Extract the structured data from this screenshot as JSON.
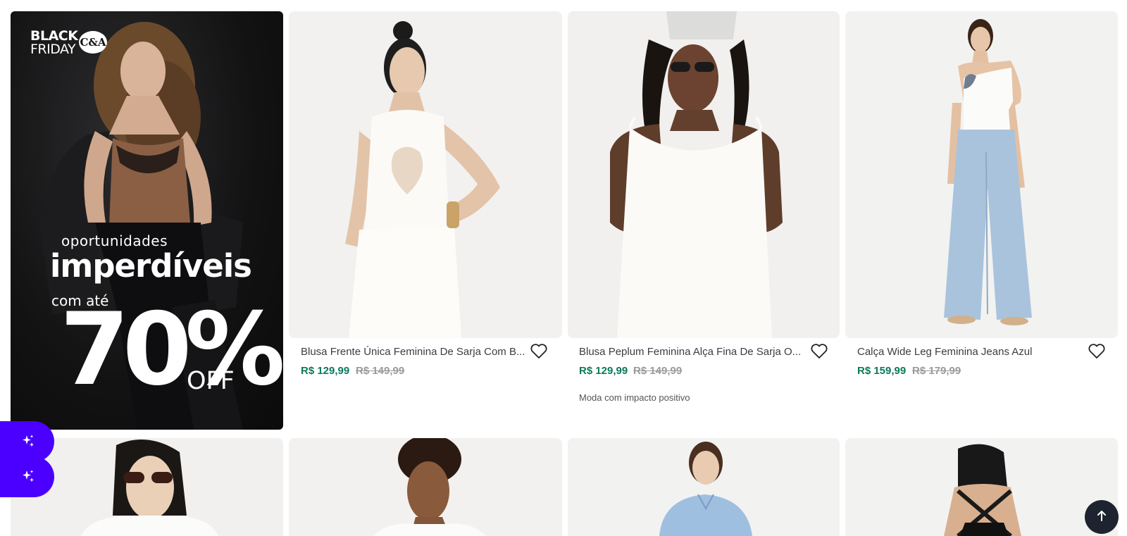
{
  "banner": {
    "logo_black": "BLACK",
    "logo_friday": "FRIDAY",
    "logo_brand": "C&A",
    "line1": "oportunidades",
    "line2": "imperdíveis",
    "line3": "com até",
    "big": "70%",
    "off": "OFF"
  },
  "products": [
    {
      "name": "Blusa Frente Única Feminina De Sarja Com Bordado Off White",
      "display_name": "Blusa Frente Única Feminina De Sarja Com B...",
      "price": "R$ 129,99",
      "old_price": "R$ 149,99",
      "tag": ""
    },
    {
      "name": "Blusa Peplum Feminina Alça Fina De Sarja Off White",
      "display_name": "Blusa Peplum Feminina Alça Fina De Sarja O...",
      "price": "R$ 129,99",
      "old_price": "R$ 149,99",
      "tag": "Moda com impacto positivo"
    },
    {
      "name": "Calça Wide Leg Feminina Jeans Azul",
      "display_name": "Calça Wide Leg Feminina Jeans Azul",
      "price": "R$ 159,99",
      "old_price": "R$ 179,99",
      "tag": ""
    }
  ],
  "colors": {
    "price": "#0b7a5a",
    "old_price": "#9a9a9a",
    "assistant": "#4b00ff",
    "back_to_top": "#1d2430"
  },
  "icons": {
    "favorite": "heart-icon",
    "assistant": "sparkles-icon",
    "back_to_top": "arrow-up-icon"
  }
}
